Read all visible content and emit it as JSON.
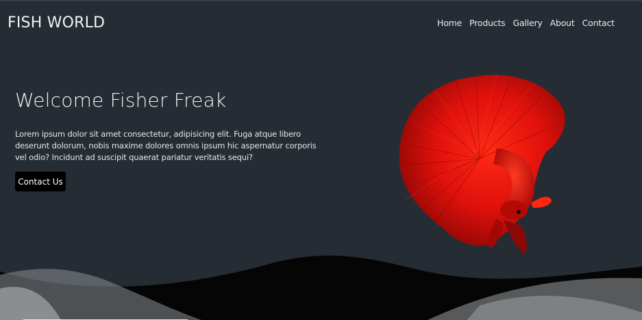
{
  "brand": {
    "name": "FISH WORLD"
  },
  "nav": {
    "items": [
      {
        "label": "Home"
      },
      {
        "label": "Products"
      },
      {
        "label": "Gallery"
      },
      {
        "label": "About"
      },
      {
        "label": "Contact"
      }
    ]
  },
  "hero": {
    "title": "Welcome Fisher Freak",
    "text": "Lorem ipsum dolor sit amet consectetur, adipisicing elit. Fuga atque libero deserunt dolorum, nobis maxime dolores omnis ipsum hic aspernatur corporis vel odio? Incidunt ad suscipit quaerat pariatur veritatis sequi?",
    "button_label": "Contact Us",
    "image": "red-betta-fish"
  },
  "colors": {
    "background": "#262c33",
    "text": "#f3f5f7",
    "button_bg": "#000000",
    "fish_red": "#e0110c"
  }
}
